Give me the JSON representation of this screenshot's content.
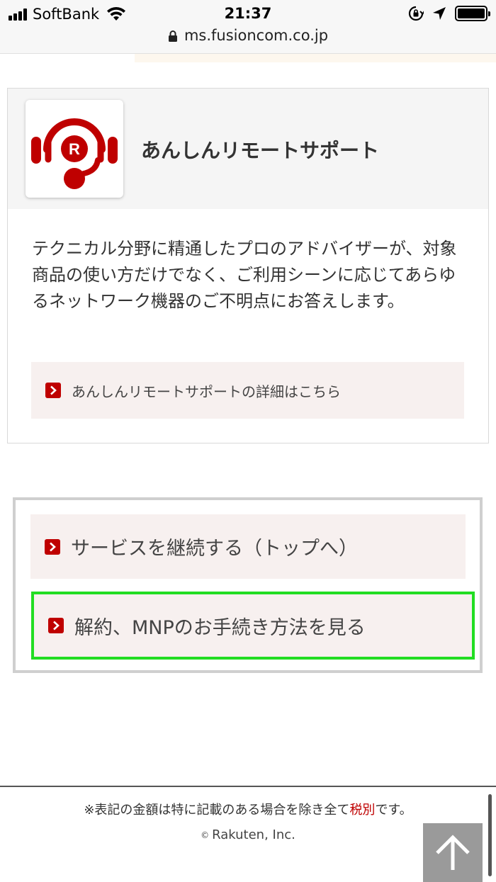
{
  "status_bar": {
    "carrier": "SoftBank",
    "time": "21:37"
  },
  "url_bar": {
    "url": "ms.fusioncom.co.jp"
  },
  "support_card": {
    "title": "あんしんリモートサポート",
    "description": "テクニカル分野に精通したプロのアドバイザーが、対象商品の使い方だけでなく、ご利用シーンに応じてあらゆるネットワーク機器のご不明点にお答えします。",
    "detail_link": "あんしんリモートサポートの詳細はこちら",
    "icon_letter": "R"
  },
  "actions": {
    "continue_label": "サービスを継続する（トップへ）",
    "cancel_label": "解約、MNPのお手続き方法を見る"
  },
  "footer": {
    "tax_note_prefix": "※表記の金額は特に記載のある場合を除き全て",
    "tax_note_highlight": "税別",
    "tax_note_suffix": "です。",
    "copyright_symbol": "©",
    "copyright": "Rakuten, Inc."
  },
  "colors": {
    "brand_red": "#bf0000",
    "highlight_green": "#22dd22",
    "button_bg": "#f7f0ef"
  }
}
